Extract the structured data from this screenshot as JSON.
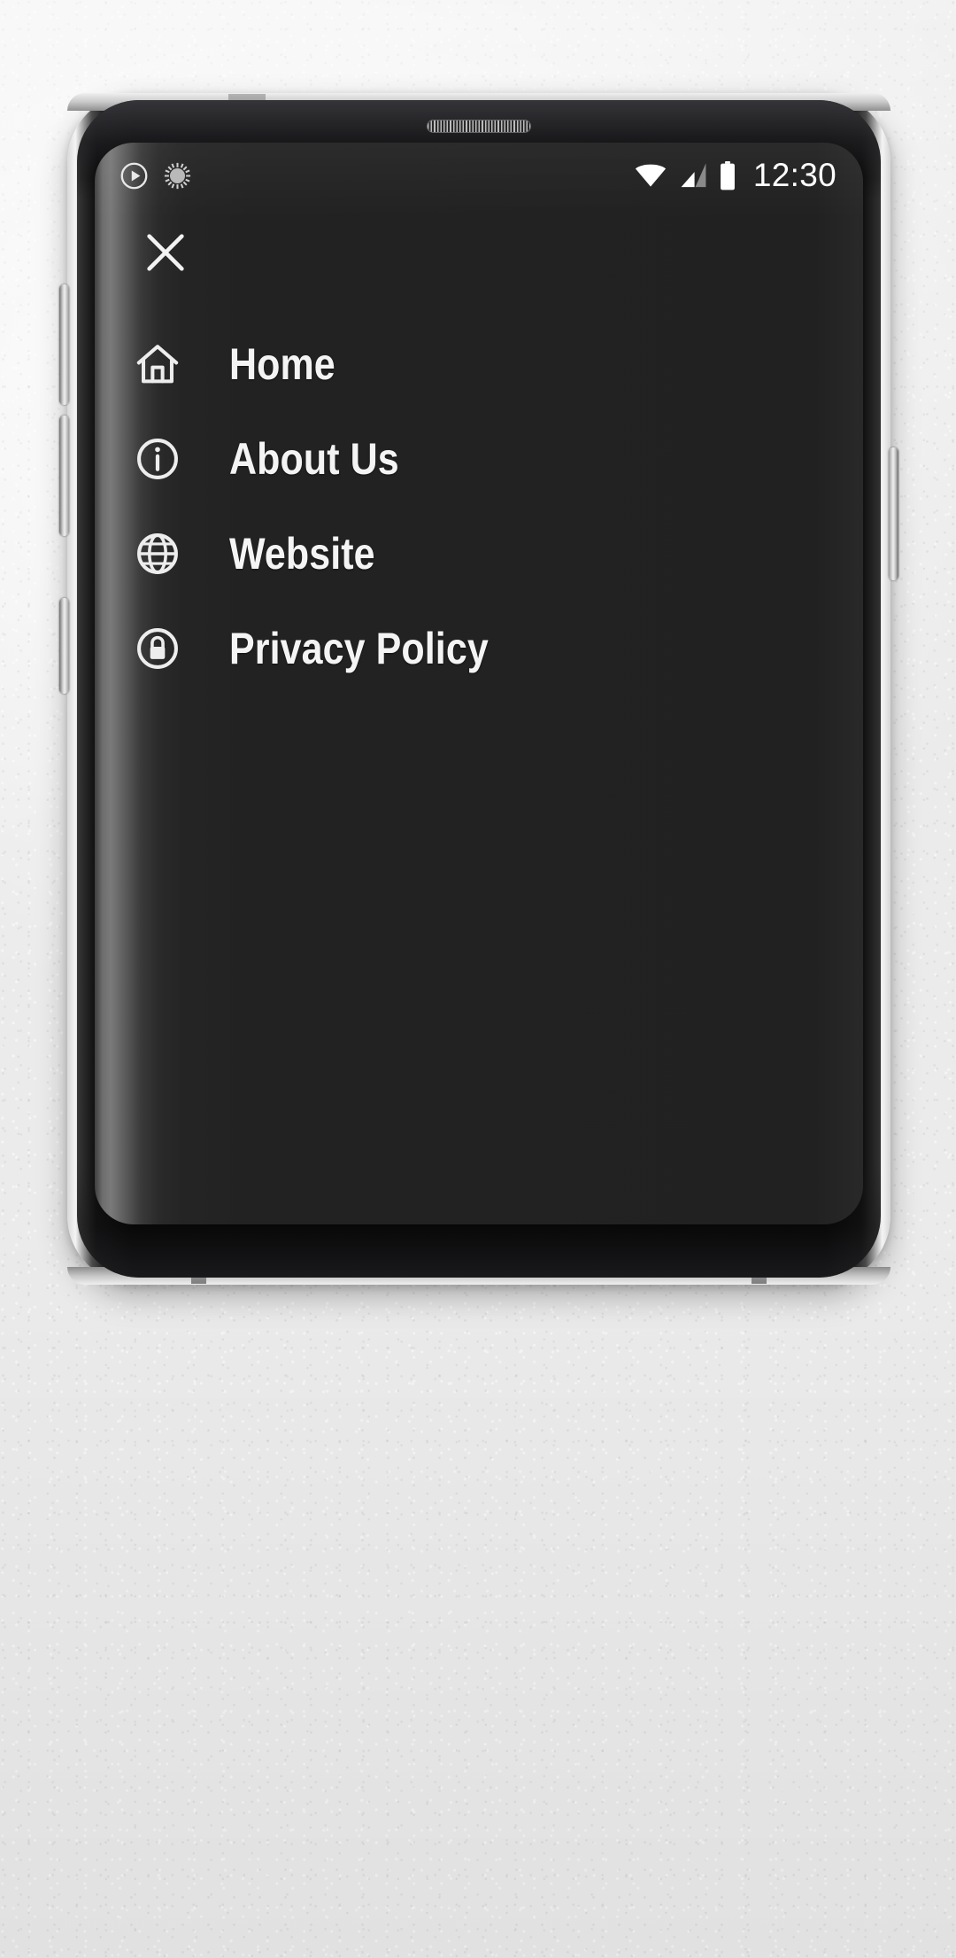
{
  "device": {
    "name": "smartphone-mockup",
    "earpiece": "earpiece-speaker-grille",
    "buttons": {
      "volume_up": "volume-up-button",
      "volume_down": "volume-down-button",
      "assistant": "assistant-button",
      "power": "power-button"
    }
  },
  "status_bar": {
    "left_icons": [
      {
        "name": "play-circle-icon"
      },
      {
        "name": "sunburst-icon"
      }
    ],
    "right_icons": [
      {
        "name": "wifi-icon"
      },
      {
        "name": "cellular-signal-icon"
      },
      {
        "name": "battery-icon"
      }
    ],
    "time": "12:30"
  },
  "drawer": {
    "close_label": "Close",
    "close_icon": "close-x-icon",
    "items": [
      {
        "label": "Home",
        "icon": "home-icon"
      },
      {
        "label": "About Us",
        "icon": "info-circle-icon"
      },
      {
        "label": "Website",
        "icon": "globe-icon"
      },
      {
        "label": "Privacy Policy",
        "icon": "lock-circle-icon"
      }
    ]
  },
  "colors": {
    "drawer_background": "#212121",
    "text": "#f4f4f4",
    "icon": "#ededed",
    "wall": "#f0f0f0"
  }
}
